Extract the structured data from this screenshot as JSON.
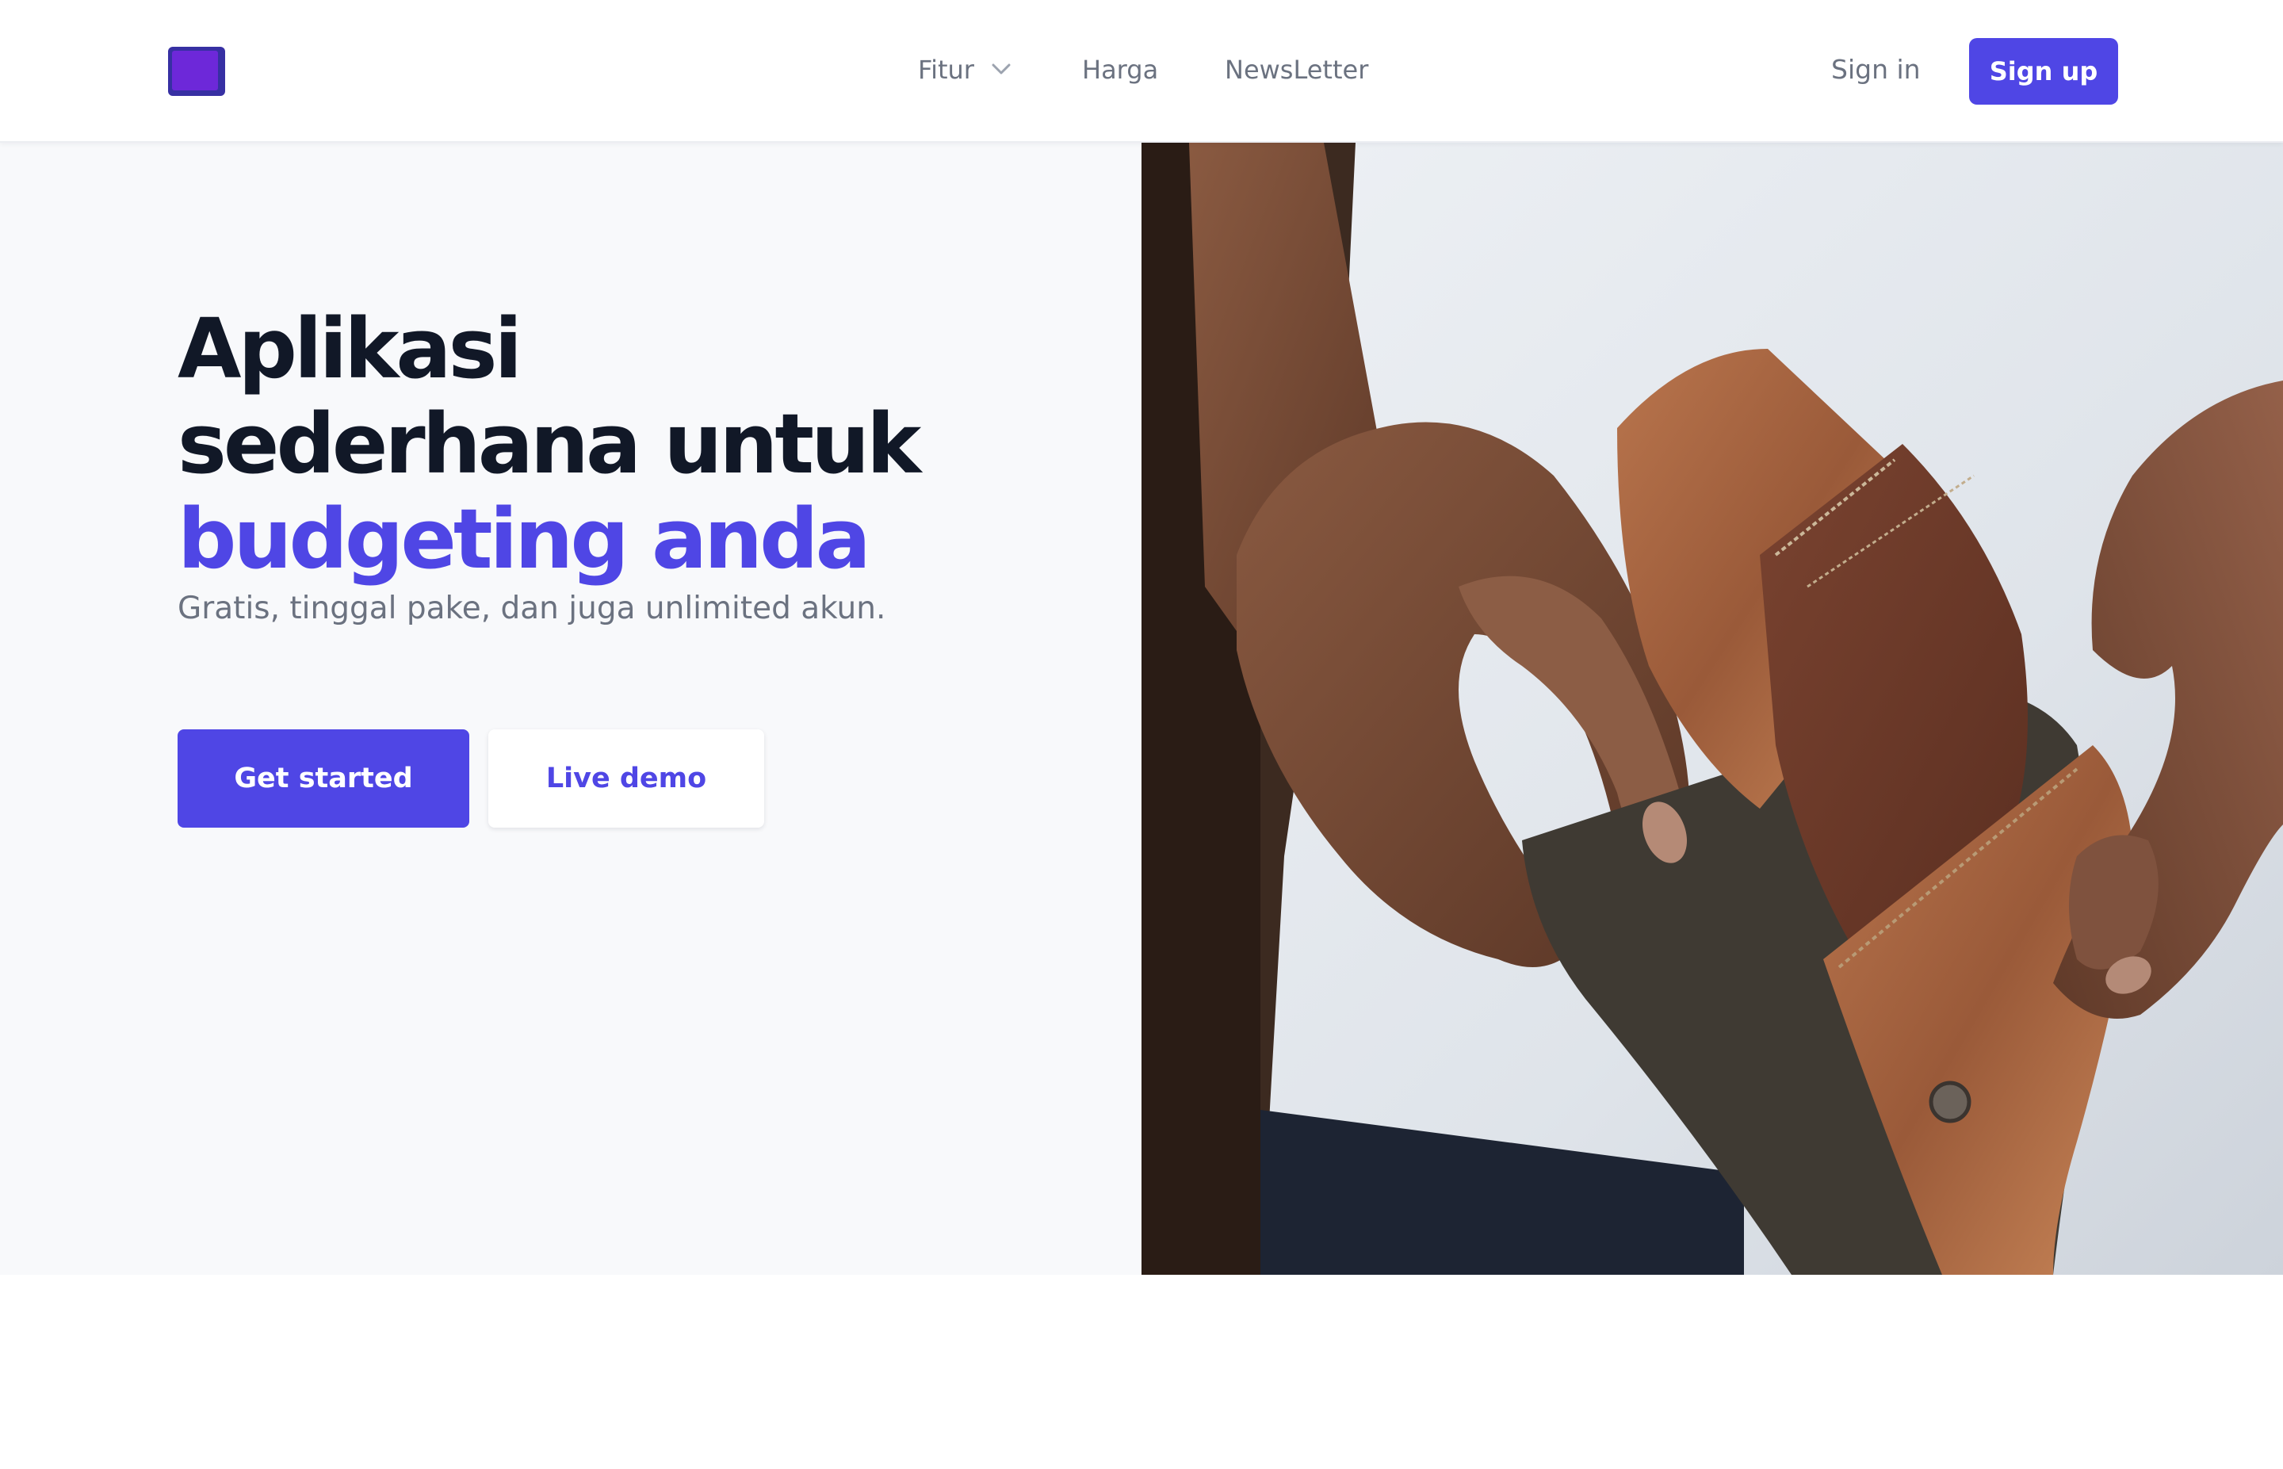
{
  "header": {
    "nav": [
      {
        "label": "Fitur",
        "has_dropdown": true
      },
      {
        "label": "Harga"
      },
      {
        "label": "NewsLetter"
      }
    ],
    "signin_label": "Sign in",
    "signup_label": "Sign up"
  },
  "hero": {
    "title_line1": "Aplikasi",
    "title_line2": "sederhana untuk",
    "title_accent": "budgeting anda",
    "subtitle": "Gratis, tinggal pake, dan juga unlimited akun.",
    "primary_cta": "Get started",
    "secondary_cta": "Live demo",
    "image_description_icon": "empty-wallet-photo"
  },
  "colors": {
    "accent": "#4f46e5",
    "heading": "#111827",
    "muted": "#6b7280",
    "hero_bg": "#f8f9fb",
    "logo": "#6d28d9"
  }
}
